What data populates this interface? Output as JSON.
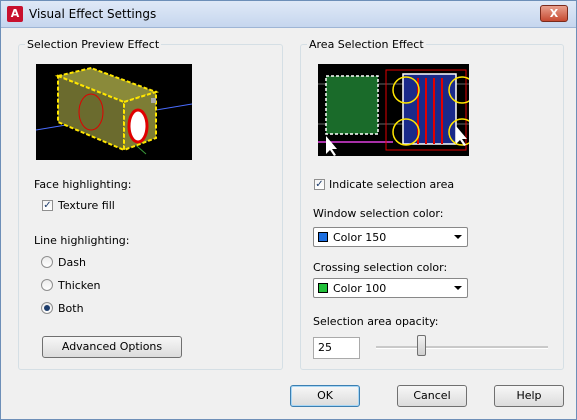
{
  "window": {
    "title": "Visual Effect Settings",
    "close_label": "X",
    "app_icon_letter": "A"
  },
  "left_group": {
    "title": "Selection Preview Effect",
    "face_highlighting_label": "Face highlighting:",
    "texture_fill": {
      "label": "Texture fill",
      "checked": true,
      "mark": "✓"
    },
    "line_highlighting_label": "Line highlighting:",
    "radios": [
      {
        "label": "Dash",
        "checked": false
      },
      {
        "label": "Thicken",
        "checked": false
      },
      {
        "label": "Both",
        "checked": true
      }
    ],
    "advanced_button": "Advanced Options"
  },
  "right_group": {
    "title": "Area Selection Effect",
    "indicate_area": {
      "label": "Indicate selection area",
      "checked": true,
      "mark": "✓"
    },
    "window_color_label": "Window selection color:",
    "window_color": {
      "value": "Color 150",
      "swatch": "#1d6fe0"
    },
    "crossing_color_label": "Crossing selection color:",
    "crossing_color": {
      "value": "Color 100",
      "swatch": "#22c03a"
    },
    "opacity_label": "Selection area opacity:",
    "opacity_value": "25",
    "opacity_slider_fraction": 0.25
  },
  "buttons": {
    "ok": "OK",
    "cancel": "Cancel",
    "help": "Help"
  },
  "colors": {
    "title_bar": "#c6d6ee",
    "close_button": "#c64a32",
    "preview_bg": "#000000",
    "highlight_yellow": "#ffe600"
  }
}
